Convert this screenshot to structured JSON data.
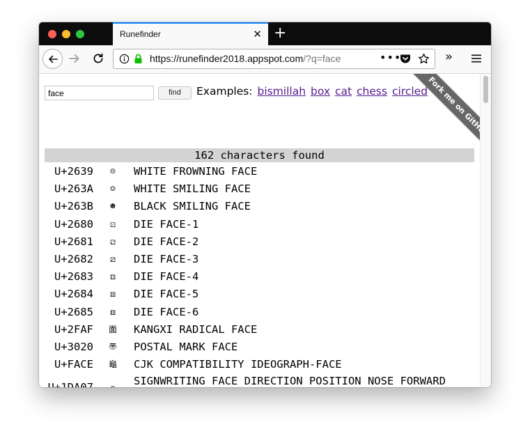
{
  "browser": {
    "tab_title": "Runefinder",
    "url_host": "https://runefinder2018.appspot.com",
    "url_rest": "/?q=face",
    "more_glyph": "•••",
    "overflow_glyph": "»",
    "tab_close_glyph": "✕",
    "newtab_glyph": "+",
    "accent_color": "#0a84ff",
    "lock_color": "#12bc00"
  },
  "search": {
    "query": "face",
    "button_label": "find"
  },
  "examples": {
    "label": "Examples:",
    "links": [
      "bismillah",
      "box",
      "cat",
      "chess",
      "circled"
    ]
  },
  "ribbon": {
    "label": "Fork me on GitHub"
  },
  "results": {
    "summary": "162 characters found",
    "rows": [
      {
        "code": "U+2639",
        "glyph": "☹",
        "name": "WHITE FROWNING FACE"
      },
      {
        "code": "U+263A",
        "glyph": "☺",
        "name": "WHITE SMILING FACE"
      },
      {
        "code": "U+263B",
        "glyph": "☻",
        "name": "BLACK SMILING FACE"
      },
      {
        "code": "U+2680",
        "glyph": "⚀",
        "name": "DIE FACE-1"
      },
      {
        "code": "U+2681",
        "glyph": "⚁",
        "name": "DIE FACE-2"
      },
      {
        "code": "U+2682",
        "glyph": "⚂",
        "name": "DIE FACE-3"
      },
      {
        "code": "U+2683",
        "glyph": "⚃",
        "name": "DIE FACE-4"
      },
      {
        "code": "U+2684",
        "glyph": "⚄",
        "name": "DIE FACE-5"
      },
      {
        "code": "U+2685",
        "glyph": "⚅",
        "name": "DIE FACE-6"
      },
      {
        "code": "U+2FAF",
        "glyph": "⾯",
        "name": "KANGXI RADICAL FACE"
      },
      {
        "code": "U+3020",
        "glyph": "〠",
        "name": "POSTAL MARK FACE"
      },
      {
        "code": "U+FACE",
        "glyph": "龜",
        "name": "CJK COMPATIBILITY IDEOGRAPH-FACE"
      },
      {
        "code": "U+1DA07",
        "glyph": "▫",
        "name": "SIGNWRITING FACE DIRECTION POSITION NOSE FORWARD TILTING"
      }
    ]
  }
}
